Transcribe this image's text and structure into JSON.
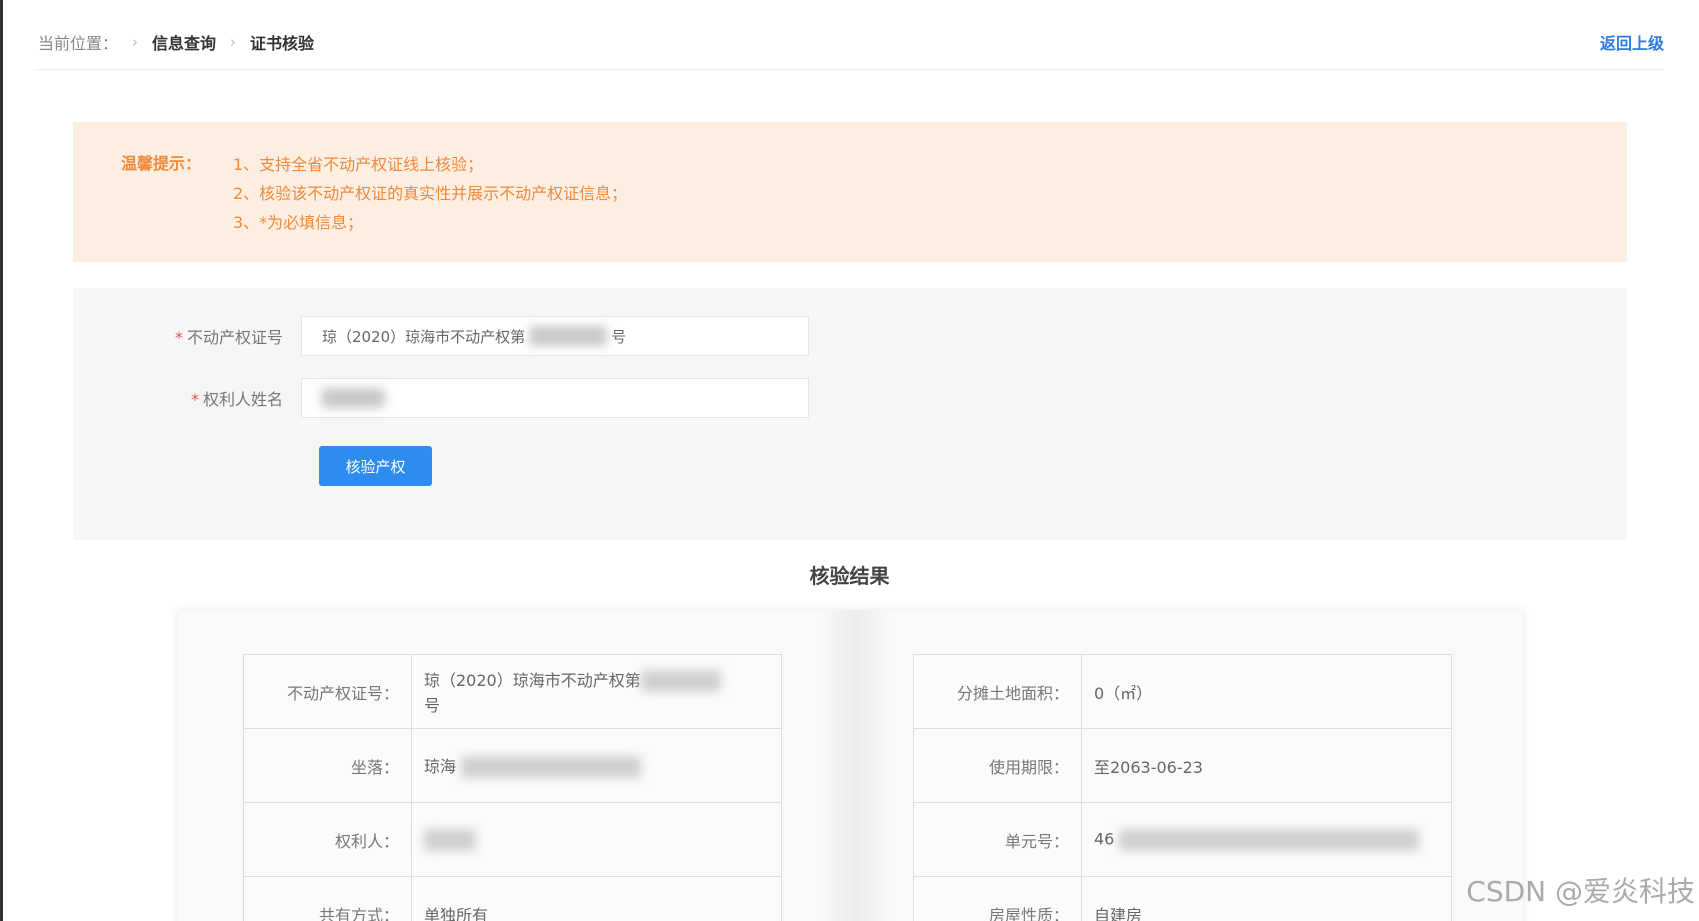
{
  "breadcrumb": {
    "label": "当前位置：",
    "items": [
      "信息查询",
      "证书核验"
    ],
    "back": "返回上级"
  },
  "tip": {
    "title": "温馨提示：",
    "lines": [
      "1、支持全省不动产权证线上核验；",
      "2、核验该不动产权证的真实性并展示不动产权证信息；",
      "3、*为必填信息；"
    ]
  },
  "form": {
    "cert_label": "不动产权证号",
    "cert_value_prefix": "琼（2020）琼海市不动产权第",
    "cert_value_suffix": "号",
    "name_label": "权利人姓名",
    "required_mark": "*",
    "submit_label": "核验产权"
  },
  "result": {
    "title": "核验结果",
    "left": [
      {
        "key": "不动产权证号：",
        "value": "琼（2020）琼海市不动产权第",
        "value_suffix": "号"
      },
      {
        "key": "坐落：",
        "value": "琼海"
      },
      {
        "key": "权利人：",
        "value": ""
      },
      {
        "key": "共有方式：",
        "value": "单独所有"
      }
    ],
    "right": [
      {
        "key": "分摊土地面积：",
        "value": "0（㎡）"
      },
      {
        "key": "使用期限：",
        "value": "至2063-06-23"
      },
      {
        "key": "单元号：",
        "value": "46"
      },
      {
        "key": "房屋性质：",
        "value": "自建房"
      }
    ]
  },
  "watermark": "CSDN @爱炎科技",
  "colors": {
    "accent": "#2d8cf0",
    "tip_text": "#f08a3c",
    "tip_bg": "#fdeee2",
    "link": "#2d7be0"
  }
}
